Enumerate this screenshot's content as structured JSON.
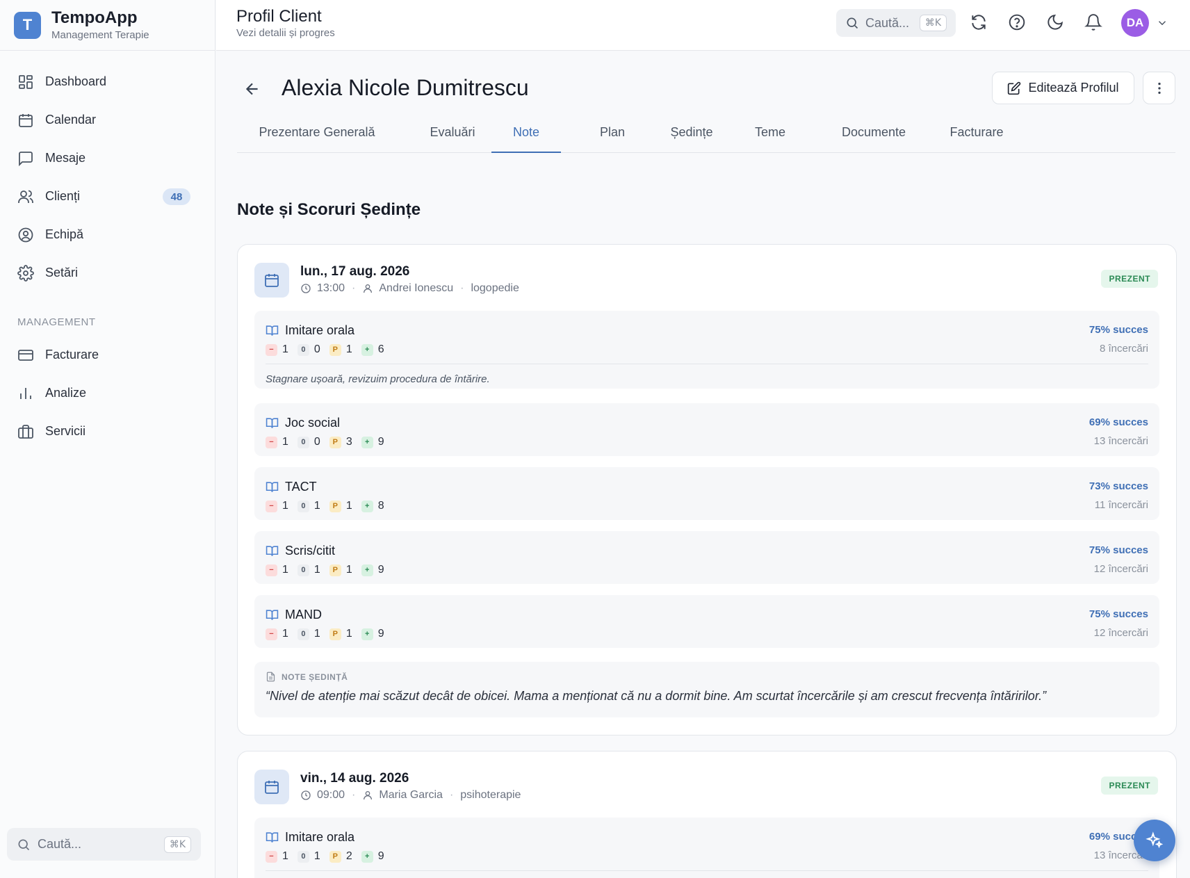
{
  "brand": {
    "logo_letter": "T",
    "name": "TempoApp",
    "subtitle": "Management Terapie",
    "color": "#4f83d1"
  },
  "sidebar": {
    "items": [
      {
        "label": "Dashboard",
        "icon": "dashboard-icon"
      },
      {
        "label": "Calendar",
        "icon": "calendar-icon"
      },
      {
        "label": "Mesaje",
        "icon": "message-icon"
      },
      {
        "label": "Clienți",
        "icon": "users-icon",
        "badge": "48"
      },
      {
        "label": "Echipă",
        "icon": "user-circle-icon"
      },
      {
        "label": "Setări",
        "icon": "gear-icon"
      }
    ],
    "section_label": "MANAGEMENT",
    "management_items": [
      {
        "label": "Facturare",
        "icon": "credit-card-icon"
      },
      {
        "label": "Analize",
        "icon": "bar-chart-icon"
      },
      {
        "label": "Servicii",
        "icon": "briefcase-icon"
      }
    ],
    "search": {
      "placeholder": "Caută...",
      "shortcut": "⌘K"
    }
  },
  "topbar": {
    "title": "Profil Client",
    "subtitle": "Vezi detalii și progres",
    "search": {
      "placeholder": "Caută...",
      "shortcut": "⌘K"
    },
    "avatar_initials": "DA",
    "avatar_color": "#9b5de5"
  },
  "client": {
    "name": "Alexia Nicole Dumitrescu",
    "edit_label": "Editează Profilul"
  },
  "tabs": [
    {
      "label": "Prezentare Generală",
      "active": false
    },
    {
      "label": "Evaluări",
      "active": false
    },
    {
      "label": "Note",
      "active": true
    },
    {
      "label": "Plan",
      "active": false
    },
    {
      "label": "Ședințe",
      "active": false
    },
    {
      "label": "Teme",
      "active": false
    },
    {
      "label": "Documente",
      "active": false
    },
    {
      "label": "Facturare",
      "active": false
    }
  ],
  "section_title": "Note și Scoruri Ședințe",
  "sessions": [
    {
      "date": "lun., 17 aug. 2026",
      "time": "13:00",
      "therapist": "Andrei Ionescu",
      "service": "logopedie",
      "status": "PREZENT",
      "exercises": [
        {
          "name": "Imitare orala",
          "minus": "1",
          "zero": "0",
          "prompt": "1",
          "plus": "6",
          "rate": "75% succes",
          "tries": "8 încercări",
          "note": "Stagnare ușoară, revizuim procedura de întărire."
        },
        {
          "name": "Joc social",
          "minus": "1",
          "zero": "0",
          "prompt": "3",
          "plus": "9",
          "rate": "69% succes",
          "tries": "13 încercări"
        },
        {
          "name": "TACT",
          "minus": "1",
          "zero": "1",
          "prompt": "1",
          "plus": "8",
          "rate": "73% succes",
          "tries": "11 încercări"
        },
        {
          "name": "Scris/citit",
          "minus": "1",
          "zero": "1",
          "prompt": "1",
          "plus": "9",
          "rate": "75% succes",
          "tries": "12 încercări"
        },
        {
          "name": "MAND",
          "minus": "1",
          "zero": "1",
          "prompt": "1",
          "plus": "9",
          "rate": "75% succes",
          "tries": "12 încercări"
        }
      ],
      "notes_label": "NOTE ȘEDINȚĂ",
      "notes_text": "“Nivel de atenție mai scăzut decât de obicei. Mama a menționat că nu a dormit bine. Am scurtat încercările și am crescut frecvența întăririlor.”"
    },
    {
      "date": "vin., 14 aug. 2026",
      "time": "09:00",
      "therapist": "Maria Garcia",
      "service": "psihoterapie",
      "status": "PREZENT",
      "exercises": [
        {
          "name": "Imitare orala",
          "minus": "1",
          "zero": "1",
          "prompt": "2",
          "plus": "9",
          "rate": "69% succes",
          "tries": "13 încercări"
        }
      ]
    }
  ],
  "chip_symbols": {
    "minus": "−",
    "zero": "0",
    "prompt": "P",
    "plus": "+"
  }
}
